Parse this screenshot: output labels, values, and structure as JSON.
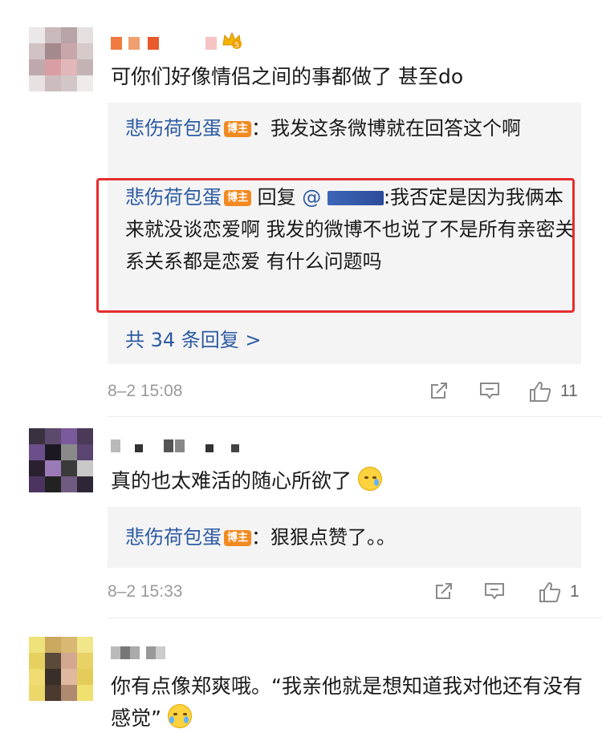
{
  "comments": [
    {
      "text": "可你们好像情侣之间的事都做了 甚至do",
      "replies": [
        {
          "author": "悲伤荷包蛋",
          "badge": "博主",
          "sep": "：",
          "text": "我发这条微博就在回答这个啊"
        },
        {
          "author": "悲伤荷包蛋",
          "badge": "博主",
          "reply_word": " 回复",
          "mention": "@",
          "sep": ":",
          "text": "我否定是因为我俩本来就没谈恋爱啊 我发的微博不也说了不是所有亲密关系关系都是恋爱 有什么问题吗"
        }
      ],
      "more_replies": "共 34 条回复 >",
      "time": "8–2 15:08",
      "likes": "11",
      "icons": [
        "share-icon",
        "comment-icon",
        "thumbs-up-icon"
      ]
    },
    {
      "text": "真的也太难活的随心所欲了",
      "emoji": "cry-emoji",
      "replies": [
        {
          "author": "悲伤荷包蛋",
          "badge": "博主",
          "sep": "：",
          "text": "狠狠点赞了。。"
        }
      ],
      "time": "8–2 15:33",
      "likes": "1"
    },
    {
      "text": "你有点像郑爽哦。“我亲他就是想知道我对他还有没有感觉”",
      "emoji": "laugh-cry-emoji"
    }
  ],
  "colors": {
    "author_link": "#2b5aa2",
    "badge": "#f28a21",
    "highlight_border": "#e52d2d",
    "reply_bg": "#f4f4f4"
  }
}
